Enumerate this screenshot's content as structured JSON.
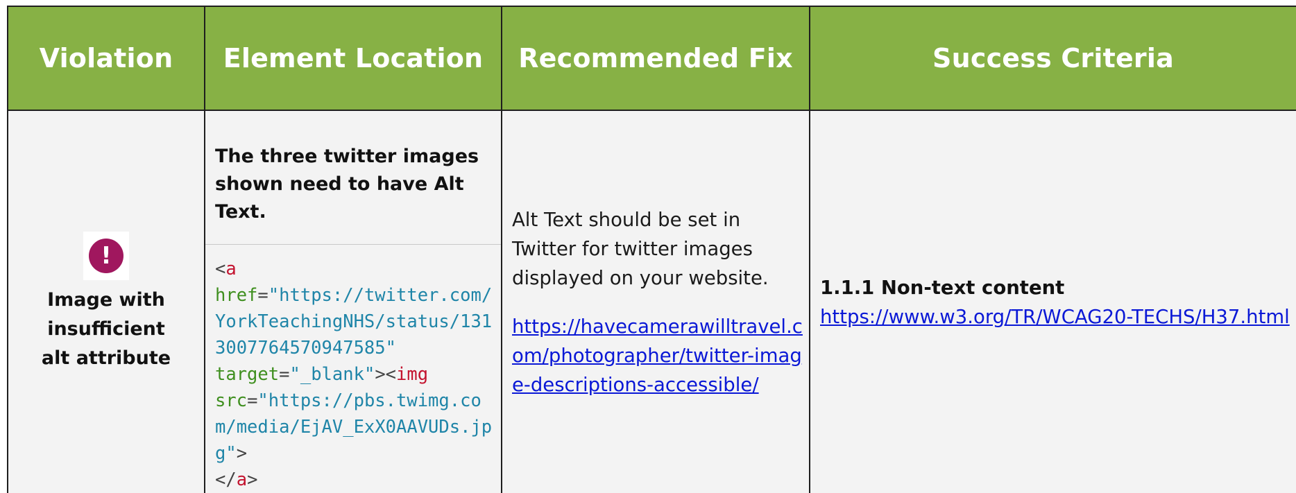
{
  "header": {
    "violation": "Violation",
    "element_location": "Element Location",
    "recommended_fix": "Recommended Fix",
    "success_criteria": "Success Criteria",
    "background_color": "#87b145"
  },
  "row": {
    "violation": {
      "icon": "error-exclamation-icon",
      "icon_glyph": "!",
      "icon_color": "#a0175e",
      "title": "Image with insufficient alt attribute"
    },
    "element_location": {
      "description": "The three twitter images shown need to have Alt Text.",
      "code": {
        "open_lt": "<",
        "a_tag": "a",
        "href_attr": "href",
        "eq1": "=",
        "href_value": "\"https://twitter.com/YorkTeachingNHS/status/1313007764570947585\"",
        "target_attr": "target",
        "eq2": "=",
        "target_value": "\"_blank\"",
        "gt_lt": "><",
        "img_tag": "img",
        "src_attr": "src",
        "eq3": "=",
        "src_value": "\"https://pbs.twimg.com/media/EjAV_ExX0AAVUDs.jpg\"",
        "close_gt": ">",
        "close_open": "</",
        "close_a_tag": "a",
        "close_end": ">"
      }
    },
    "recommended_fix": {
      "text": "Alt Text should be set in Twitter for twitter images displayed on your website.",
      "link": "https://havecamerawilltravel.com/photographer/twitter-image-descriptions-accessible/"
    },
    "success_criteria": {
      "title": "1.1.1 Non-text content",
      "link": "https://www.w3.org/TR/WCAG20-TECHS/H37.html"
    }
  },
  "colors": {
    "link": "#0a18d6",
    "code_tag": "#c3122e",
    "code_attr": "#3f8f1f",
    "code_value": "#1f85a8"
  }
}
